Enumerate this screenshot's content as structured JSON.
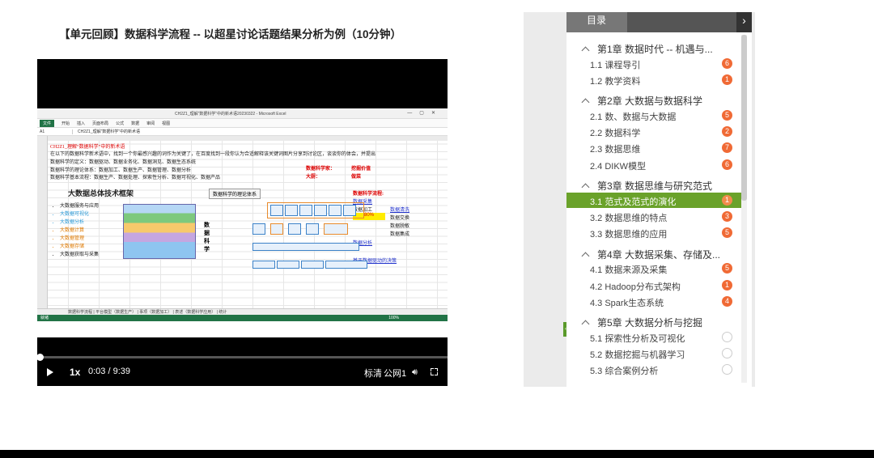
{
  "slide_title": "【单元回顾】数据科学流程 -- 以超星讨论话题结果分析为例（10分钟）",
  "excel": {
    "title_bar": "CH2Z1_理解“数据科学”中的新术语20230322 - Microsoft Excel",
    "ribbon_tabs": [
      "文件",
      "开始",
      "插入",
      "页面布局",
      "公式",
      "数据",
      "审阅",
      "视图"
    ],
    "name_box": "A1",
    "formula": "CH2Z1_理解“数据科学”中的新术语",
    "cells": {
      "r1": "CH2Z1_理解“数据科学”中的新术语",
      "r2": "在以下的数据科学新术语中，找到一个你最感兴趣的词作为关键了，在百度找到一段你认为合适解释该关键词图片分享到讨论区，谈谈你的体会，并提出",
      "r3": "数据科学的定义：数据驱动、数据业务化、数据洞见、数据生态系统",
      "r4": "数据科学的理论体系：数据加工、数据生产、数据管理、数据分析",
      "r5": "数据科学基本流程：数据生产、数据处理、探索性分析、数据可视化、数据产品",
      "scientist": "数据科学家：",
      "value": "挖掘价值",
      "chef": "大厨：",
      "cook": "做菜",
      "flow_title": "数据科学流程:",
      "collect": "数据采集",
      "process": "数据加工",
      "clean": "数据清洗",
      "pct": "80%",
      "transform": "数据交换",
      "desens": "数据脱敏",
      "integrate": "数据集成",
      "analysis": "数据分析",
      "decision": "基于数据驱动的决策"
    },
    "diagram1_title": "大数据总体技术框架",
    "diagram1_items": [
      "大数据服务与应用",
      "大数据可视化",
      "大数据分析",
      "大数据计算",
      "大数据管理",
      "大数据存储",
      "大数据获取与采集"
    ],
    "diagram2_title": "数据科学的理论体系",
    "diagram2_side": "数据科学",
    "sheet_tabs": "数据科学流程 | 平台模型（数据生产） | 事项（数据加工） | 表述（数据科学应用） | 统计",
    "status": "就绪",
    "zoom": "100%"
  },
  "player": {
    "progress_fraction": 0.0053,
    "speed": "1x",
    "current_time": "0:03",
    "separator": "/",
    "duration": "9:39",
    "quality": "标清",
    "line": "公网1"
  },
  "catalog": {
    "tab_label": "目录",
    "chapters": [
      {
        "title": "第1章 数据时代 -- 机遇与...",
        "sections": [
          {
            "label": "1.1 课程导引",
            "badge": "6"
          },
          {
            "label": "1.2 教学资料",
            "badge": "1"
          }
        ]
      },
      {
        "title": "第2章 大数据与数据科学",
        "sections": [
          {
            "label": "2.1 数、数据与大数据",
            "badge": "5"
          },
          {
            "label": "2.2 数据科学",
            "badge": "2"
          },
          {
            "label": "2.3 数据思维",
            "badge": "7"
          },
          {
            "label": "2.4 DIKW模型",
            "badge": "6"
          }
        ]
      },
      {
        "title": "第3章 数据思维与研究范式",
        "sections": [
          {
            "label": "3.1 范式及范式的演化",
            "badge": "1"
          },
          {
            "label": "3.2 数据思维的特点",
            "badge": "3"
          },
          {
            "label": "3.3 数据思维的应用",
            "badge": "5"
          }
        ]
      },
      {
        "title": "第4章 大数据采集、存储及...",
        "sections": [
          {
            "label": "4.1 数据来源及采集",
            "badge": "5"
          },
          {
            "label": "4.2 Hadoop分布式架构",
            "badge": "1"
          },
          {
            "label": "4.3 Spark生态系统",
            "badge": "4"
          }
        ]
      },
      {
        "title": "第5章 大数据分析与挖掘",
        "sections": [
          {
            "label": "5.1 探索性分析及可视化",
            "badge": ""
          },
          {
            "label": "5.2 数据挖掘与机器学习",
            "badge": ""
          },
          {
            "label": "5.3 综合案例分析",
            "badge": ""
          }
        ]
      }
    ],
    "colors": {
      "active": "#6aa22a",
      "badge": "#f06a35"
    }
  }
}
